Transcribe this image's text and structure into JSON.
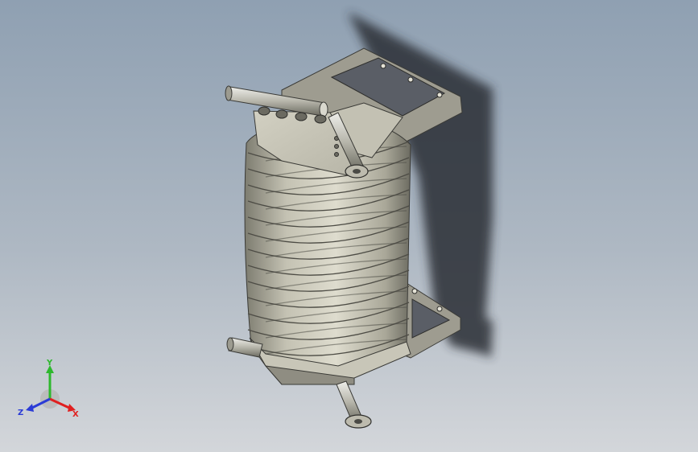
{
  "viewport": {
    "background_top": "#8fa0b2",
    "background_bottom": "#d3d6da",
    "model_color": "#c9c7b9",
    "shadow_color": "#2b2f35"
  },
  "triad": {
    "x_label": "X",
    "y_label": "Y",
    "z_label": "Z",
    "x_color": "#e02020",
    "y_color": "#2db82d",
    "z_color": "#2a3bd6"
  }
}
